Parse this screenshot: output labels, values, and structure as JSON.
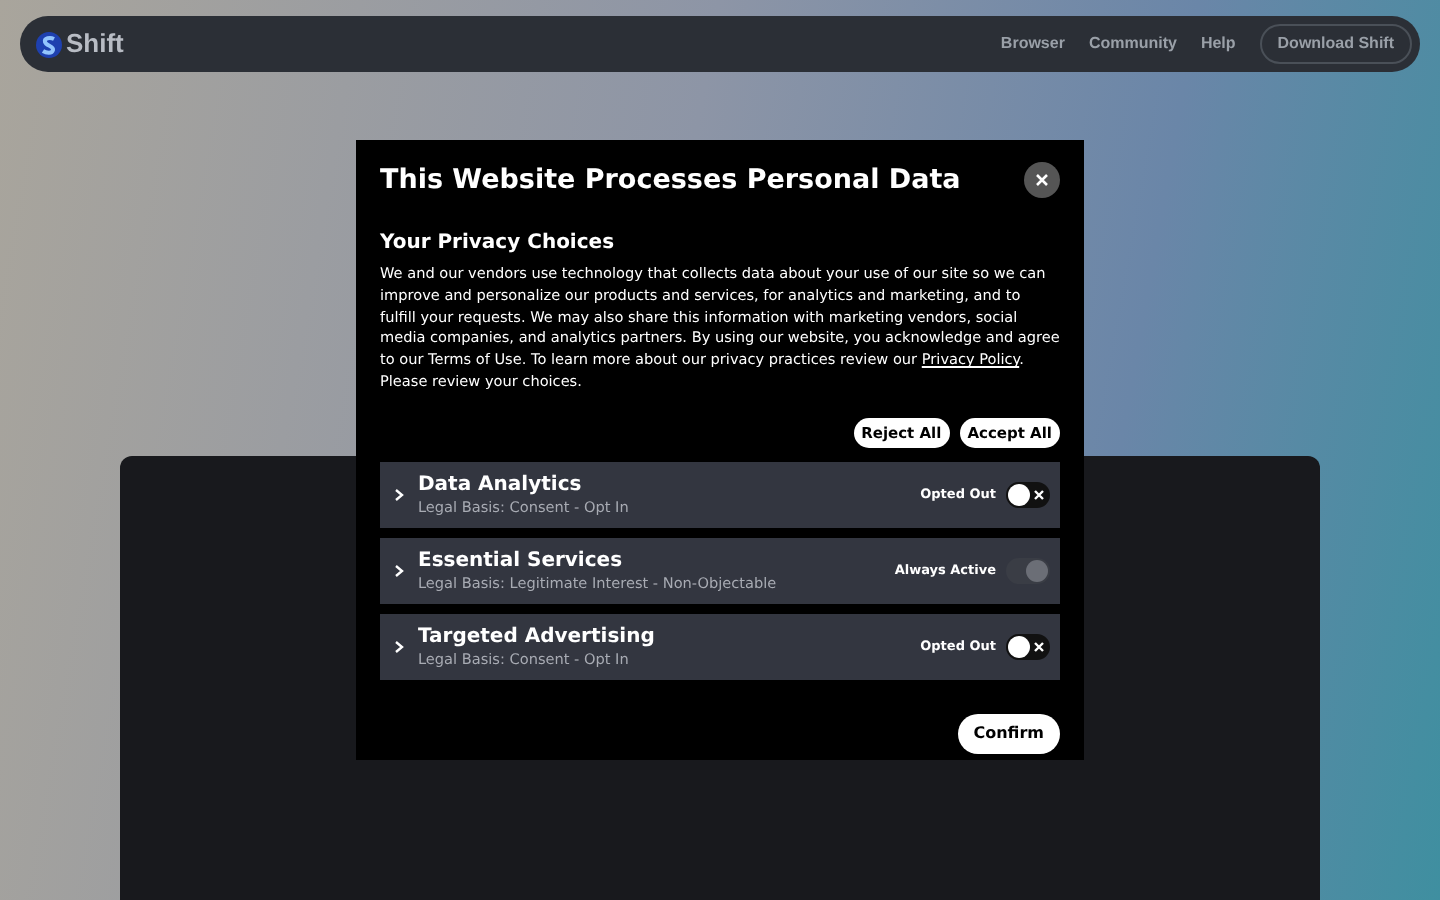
{
  "navbar": {
    "brand": "Shift",
    "links": [
      "Browser",
      "Community",
      "Help"
    ],
    "cta": "Download Shift"
  },
  "modal": {
    "title": "This Website Processes Personal Data",
    "heading": "Your Privacy Choices",
    "body": "We and our vendors use technology that collects data about your use of our site so we can improve and personalize our products and services, for analytics and marketing, and to fulfill your requests. We may also share this information with marketing vendors, social media companies, and analytics partners. By using our website, you acknowledge and agree to our Terms of Use. To learn more about our privacy practices review our",
    "link": "Privacy Policy",
    "body_end": ". Please review your choices.",
    "actions": [
      "Reject All",
      "Accept All"
    ],
    "categories": [
      {
        "name": "Data Analytics",
        "basis": "Legal Basis: Consent - Opt In",
        "status": "Opted Out",
        "on": false,
        "disabled": false,
        "expanded": false
      },
      {
        "name": "Essential Services",
        "basis": "Legal Basis: Legitimate Interest - Non-Objectable",
        "status": "Always Active",
        "on": true,
        "disabled": true,
        "expanded": false
      },
      {
        "name": "Targeted Advertising",
        "basis": "Legal Basis: Consent - Opt In",
        "status": "Opted Out",
        "on": false,
        "disabled": false,
        "expanded": false
      }
    ],
    "confirm": "Confirm"
  }
}
